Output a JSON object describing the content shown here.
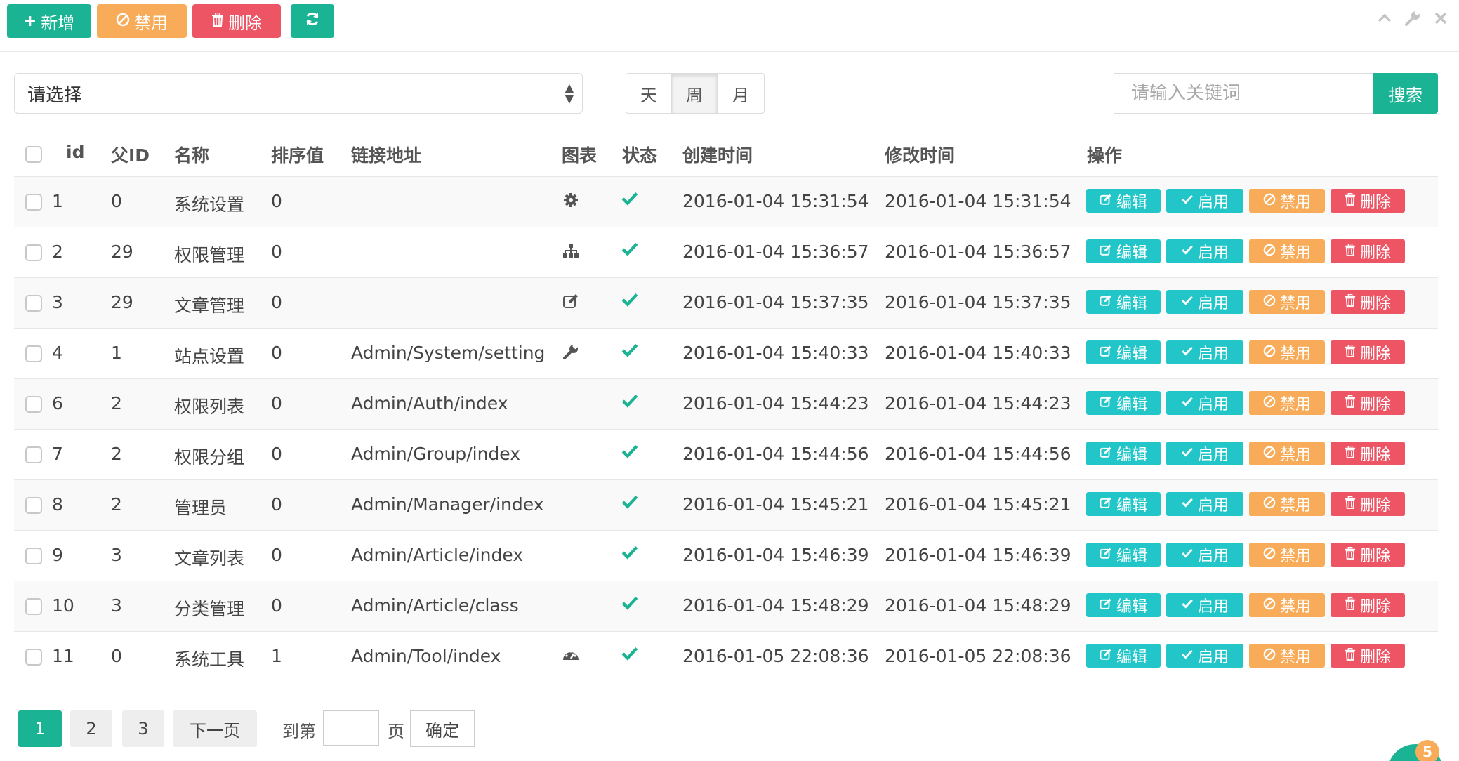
{
  "toolbar": {
    "add_label": "新增",
    "disable_label": "禁用",
    "delete_label": "删除"
  },
  "filter": {
    "select_value": "请选择",
    "range_tabs": [
      "天",
      "周",
      "月"
    ],
    "active_tab": "周",
    "search_placeholder": "请输入关键词",
    "search_label": "搜索"
  },
  "table": {
    "headers": {
      "id": "id",
      "parent_id": "父ID",
      "name": "名称",
      "sort": "排序值",
      "url": "链接地址",
      "icon": "图表",
      "status": "状态",
      "created": "创建时间",
      "modified": "修改时间",
      "actions": "操作"
    },
    "action_labels": {
      "edit": "编辑",
      "enable": "启用",
      "disable": "禁用",
      "delete": "删除"
    },
    "rows": [
      {
        "id": "1",
        "pid": "0",
        "name": "系统设置",
        "sort": "0",
        "url": "",
        "icon": "gear-icon",
        "created": "2016-01-04 15:31:54",
        "modified": "2016-01-04 15:31:54"
      },
      {
        "id": "2",
        "pid": "29",
        "name": "权限管理",
        "sort": "0",
        "url": "",
        "icon": "sitemap-icon",
        "created": "2016-01-04 15:36:57",
        "modified": "2016-01-04 15:36:57"
      },
      {
        "id": "3",
        "pid": "29",
        "name": "文章管理",
        "sort": "0",
        "url": "",
        "icon": "edit-icon",
        "created": "2016-01-04 15:37:35",
        "modified": "2016-01-04 15:37:35"
      },
      {
        "id": "4",
        "pid": "1",
        "name": "站点设置",
        "sort": "0",
        "url": "Admin/System/setting",
        "icon": "wrench-icon",
        "created": "2016-01-04 15:40:33",
        "modified": "2016-01-04 15:40:33"
      },
      {
        "id": "6",
        "pid": "2",
        "name": "权限列表",
        "sort": "0",
        "url": "Admin/Auth/index",
        "icon": "",
        "created": "2016-01-04 15:44:23",
        "modified": "2016-01-04 15:44:23"
      },
      {
        "id": "7",
        "pid": "2",
        "name": "权限分组",
        "sort": "0",
        "url": "Admin/Group/index",
        "icon": "",
        "created": "2016-01-04 15:44:56",
        "modified": "2016-01-04 15:44:56"
      },
      {
        "id": "8",
        "pid": "2",
        "name": "管理员",
        "sort": "0",
        "url": "Admin/Manager/index",
        "icon": "",
        "created": "2016-01-04 15:45:21",
        "modified": "2016-01-04 15:45:21"
      },
      {
        "id": "9",
        "pid": "3",
        "name": "文章列表",
        "sort": "0",
        "url": "Admin/Article/index",
        "icon": "",
        "created": "2016-01-04 15:46:39",
        "modified": "2016-01-04 15:46:39"
      },
      {
        "id": "10",
        "pid": "3",
        "name": "分类管理",
        "sort": "0",
        "url": "Admin/Article/class",
        "icon": "",
        "created": "2016-01-04 15:48:29",
        "modified": "2016-01-04 15:48:29"
      },
      {
        "id": "11",
        "pid": "0",
        "name": "系统工具",
        "sort": "1",
        "url": "Admin/Tool/index",
        "icon": "dashboard-icon",
        "created": "2016-01-05 22:08:36",
        "modified": "2016-01-05 22:08:36"
      }
    ]
  },
  "pagination": {
    "pages": [
      "1",
      "2",
      "3"
    ],
    "active_page": "1",
    "next_label": "下一页",
    "goto_prefix": "到第",
    "goto_suffix": "页",
    "confirm_label": "确定"
  },
  "badge_count": "5",
  "colors": {
    "primary": "#1ab394",
    "warning": "#f8ac59",
    "danger": "#ed5565",
    "info": "#23c6c8"
  }
}
